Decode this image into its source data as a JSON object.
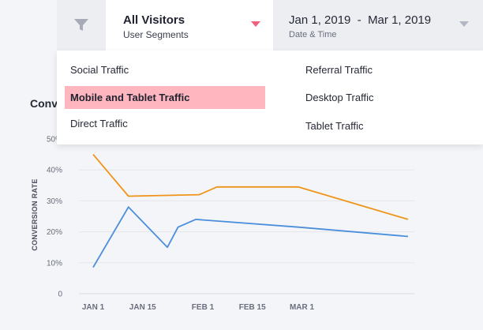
{
  "toolbar": {
    "filter_icon": "filter-icon",
    "segment": {
      "title": "All Visitors",
      "subtitle": "User Segments"
    },
    "date": {
      "range": "Jan 1, 2019  -  Mar 1, 2019",
      "subtitle": "Date & Time"
    },
    "accent_color": "#f0607a"
  },
  "segment_options": {
    "left": [
      "Social Traffic",
      "Mobile and Tablet Traffic",
      "Direct Traffic"
    ],
    "right": [
      "Referral Traffic",
      "Desktop Traffic",
      "Tablet Traffic"
    ],
    "selected": "Mobile and Tablet Traffic"
  },
  "chart": {
    "heading_visible": "Conv"
  },
  "chart_data": {
    "type": "line",
    "ylabel": "CONVERSION RATE",
    "y_ticks": [
      "0",
      "10%",
      "20%",
      "30%",
      "40%",
      "50%"
    ],
    "x_ticks": [
      "JAN 1",
      "JAN 15",
      "FEB 1",
      "FEB 15",
      "MAR 1"
    ],
    "x": [
      1,
      11,
      22,
      31,
      36,
      59,
      90
    ],
    "ylim": [
      0,
      50
    ],
    "grid": true,
    "series": [
      {
        "color": "#ef9418",
        "points": [
          [
            1,
            45
          ],
          [
            11,
            31.5
          ],
          [
            31,
            32
          ],
          [
            36,
            34.5
          ],
          [
            59,
            34.5
          ],
          [
            90,
            24
          ]
        ]
      },
      {
        "color": "#4a8fdc",
        "points": [
          [
            1,
            8.5
          ],
          [
            11,
            28
          ],
          [
            22,
            15
          ],
          [
            25,
            21.5
          ],
          [
            30,
            24
          ],
          [
            59,
            21.5
          ],
          [
            90,
            18.5
          ]
        ]
      }
    ],
    "x_tick_values": [
      1,
      15,
      32,
      46,
      60
    ]
  }
}
